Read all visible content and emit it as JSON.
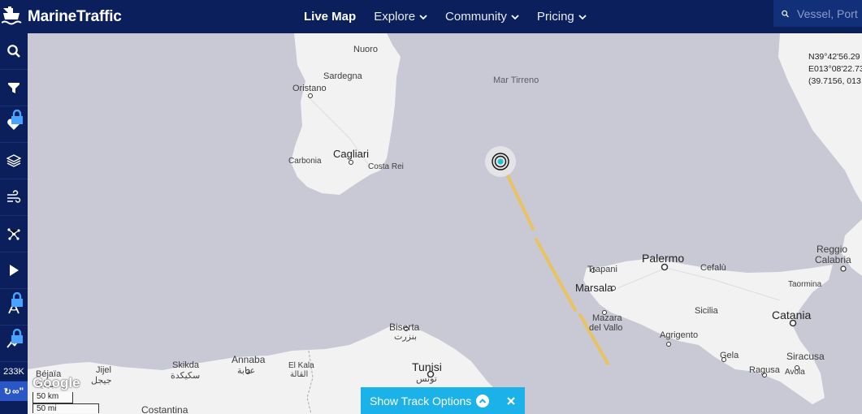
{
  "brand": {
    "name": "MarineTraffic"
  },
  "nav": {
    "items": [
      {
        "label": "Live Map",
        "active": true
      },
      {
        "label": "Explore",
        "dropdown": true
      },
      {
        "label": "Community",
        "dropdown": true
      },
      {
        "label": "Pricing",
        "dropdown": true
      }
    ]
  },
  "search": {
    "placeholder": "Vessel, Port"
  },
  "sidebar": {
    "tools": [
      {
        "name": "search-icon",
        "locked": false
      },
      {
        "name": "filter-icon",
        "locked": false
      },
      {
        "name": "heart-icon",
        "locked": true
      },
      {
        "name": "layers-icon",
        "locked": false
      },
      {
        "name": "wind-icon",
        "locked": false
      },
      {
        "name": "network-icon",
        "locked": false
      },
      {
        "name": "play-icon",
        "locked": false
      },
      {
        "name": "compass-icon",
        "locked": true
      },
      {
        "name": "chart-line-icon",
        "locked": true
      }
    ],
    "vessel_count": "233K",
    "loop_label": "∞\""
  },
  "map": {
    "places": {
      "nuoro": "Nuoro",
      "sardegna": "Sardegna",
      "oristano": "Oristano",
      "cagliari": "Cagliari",
      "carbonia": "Carbonia",
      "costa_rei": "Costa Rei",
      "mar_tirreno": "Mar Tirreno",
      "palermo": "Palermo",
      "trapani": "Trapani",
      "marsala": "Marsala",
      "mazara": "Mazara",
      "del_vallo": "del Vallo",
      "cefalu": "Cefalù",
      "sicilia": "Sicilia",
      "agrigento": "Agrigento",
      "catania": "Catania",
      "gela": "Gela",
      "ragusa": "Ragusa",
      "siracusa": "Siracusa",
      "avola": "Avola",
      "taormina": "Taormina",
      "reggio": "Reggio",
      "calabria": "Calabria",
      "bizerta": "Biserta",
      "bizerta_ar": "بنزرت",
      "tunisi": "Tunisi",
      "tunisi_ar": "تونس",
      "annaba": "Annaba",
      "annaba_ar": "عنابة",
      "el_kala": "El Kala",
      "el_kala_ar": "القالة",
      "skikda": "Skikda",
      "skikda_ar": "سكيكدة",
      "jijel": "Jijel",
      "jijel_ar": "جيجل",
      "bejaia": "Béjaïa",
      "bejaia_ar": "بجاية",
      "constantina": "Costantina"
    },
    "coords": {
      "lat": "N39°42'56.29",
      "lon": "E013°08'22.73",
      "decimal": "(39.7156, 013"
    },
    "attribution": "Google",
    "scale_km": "50 km",
    "scale_mi": "50 mi"
  },
  "track_options": {
    "label": "Show Track Options"
  },
  "colors": {
    "nav_bg": "#0b1f5c",
    "sea": "#c9c9d6",
    "land": "#f2f2f2",
    "track": "#e9c261",
    "button": "#1ab2e8"
  }
}
